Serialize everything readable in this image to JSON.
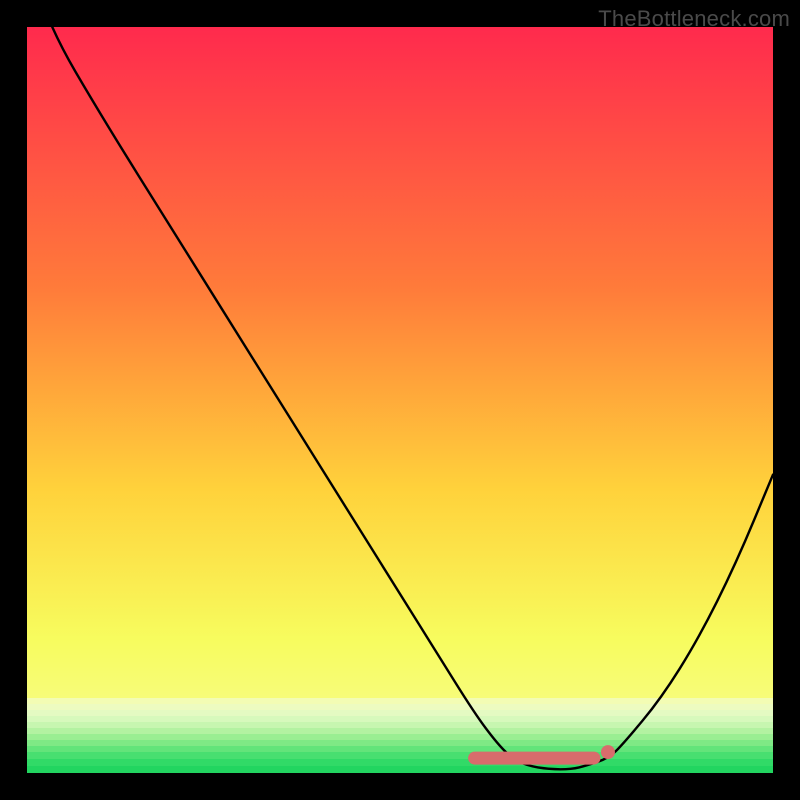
{
  "watermark": "TheBottleneck.com",
  "colors": {
    "background": "#000000",
    "plot_top": "#ff2a4d",
    "plot_mid1": "#ff7b3a",
    "plot_mid2": "#ffd23b",
    "plot_mid3": "#f7fc5e",
    "plot_bottom_band_top": "#e8fca0",
    "plot_bottom_band_bottom": "#2fe86d",
    "curve": "#000000",
    "indicator_fill": "#d86c6c",
    "indicator_stroke": "#b94f4f"
  },
  "chart_data": {
    "type": "line",
    "title": "",
    "xlabel": "",
    "ylabel": "",
    "xlim": [
      0,
      100
    ],
    "ylim": [
      0,
      100
    ],
    "grid": false,
    "legend": false,
    "x": [
      0,
      3,
      10,
      20,
      30,
      40,
      50,
      55,
      60,
      63,
      65,
      67,
      70,
      73,
      75,
      78,
      80,
      85,
      90,
      95,
      100
    ],
    "values": [
      110,
      100,
      88,
      72,
      56,
      40,
      24,
      16,
      8,
      4,
      2,
      1,
      0.5,
      0.5,
      1,
      2,
      4,
      10,
      18,
      28,
      40
    ],
    "flat_marker": {
      "x_start": 60,
      "x_end": 76,
      "y": 2
    },
    "note": "x and y are percentage-like normalized coordinates; y=0 is the bottom of the plot area, y=100 is the top. Values above 100 indicate the curve enters from outside the top-left of the visible plot area."
  }
}
